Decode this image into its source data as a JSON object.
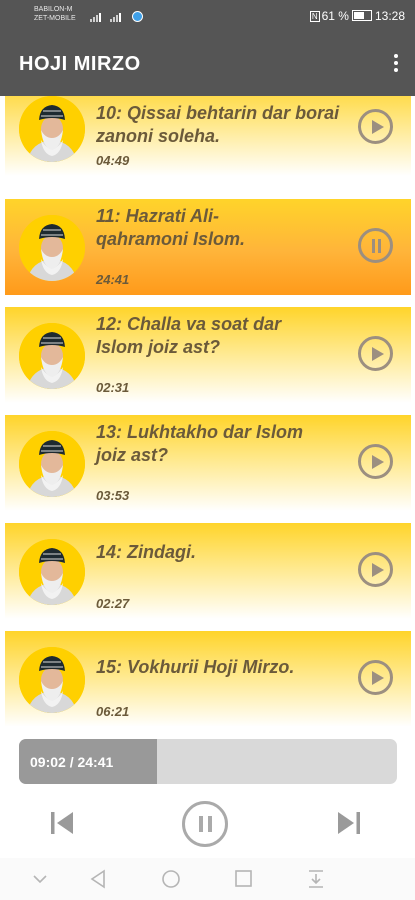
{
  "status_bar": {
    "carrier_line1": "BABILON-M",
    "carrier_line2": "ZET-MOBILE",
    "nfc": "N",
    "battery": "61 %",
    "time": "13:28"
  },
  "app_bar": {
    "title": "HOJI MIRZO",
    "menu_icon": "more-vert-icon"
  },
  "tracks": [
    {
      "title": "10:  Qissai behtarin dar borai zanoni soleha.",
      "duration": "04:49",
      "state": "paused"
    },
    {
      "title": "11:  Hazrati Ali-qahramoni Islom.",
      "duration": "24:41",
      "state": "playing"
    },
    {
      "title": "12:  Challa va soat dar Islom joiz ast?",
      "duration": "02:31",
      "state": "paused"
    },
    {
      "title": "13:  Lukhtakho dar Islom joiz ast?",
      "duration": "03:53",
      "state": "paused"
    },
    {
      "title": "14:  Zindagi.",
      "duration": "02:27",
      "state": "paused"
    },
    {
      "title": "15:  Vokhurii Hoji Mirzo.",
      "duration": "06:21",
      "state": "paused"
    }
  ],
  "player": {
    "progress_text": "09:02 / 24:41",
    "progress_fraction": 0.366,
    "prev_icon": "skip-previous-icon",
    "main_icon": "pause-circle-icon",
    "next_icon": "skip-next-icon"
  },
  "colors": {
    "bar": "#555555",
    "track_yellow": "#ffd42a",
    "track_active_orange": "#ff9a1a",
    "text_brown": "#6b5a3a"
  },
  "nav_bar": [
    "chevron-down-icon",
    "back-icon",
    "home-icon",
    "recents-icon",
    "notification-pull-icon"
  ]
}
